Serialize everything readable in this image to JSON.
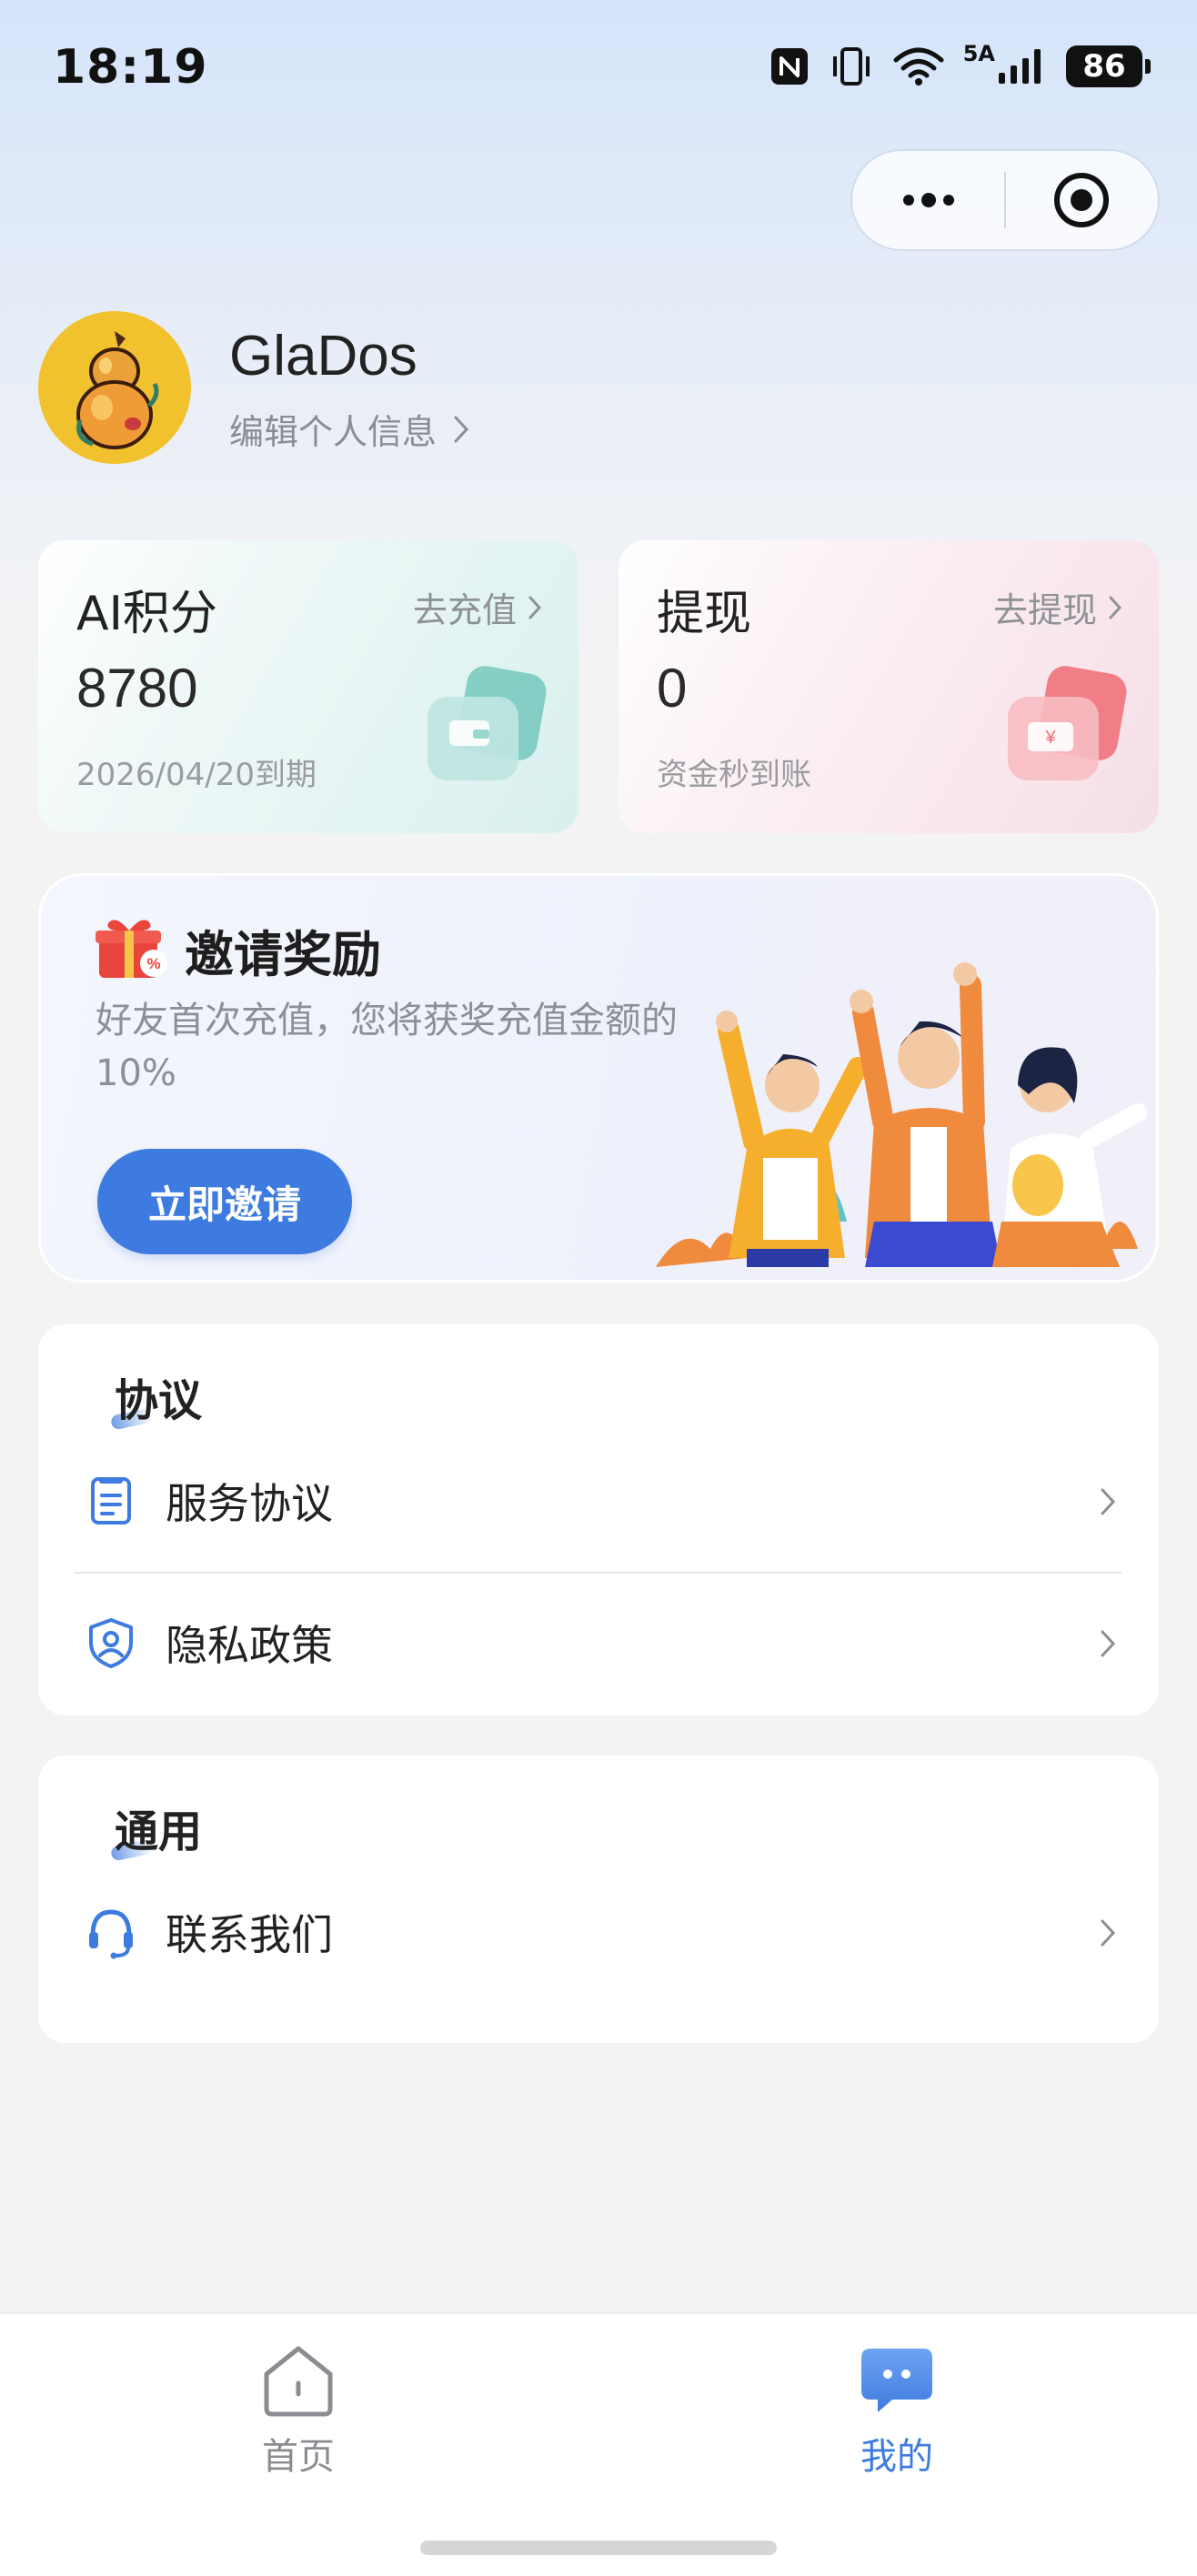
{
  "status_bar": {
    "time": "18:19",
    "network_label": "5A",
    "battery": "86",
    "icons": [
      "nfc-icon",
      "vibrate-icon",
      "wifi-icon",
      "signal-icon",
      "battery-icon"
    ]
  },
  "capsule": {
    "icons": [
      "more-dots-icon",
      "close-target-icon"
    ]
  },
  "profile": {
    "username": "GlaDos",
    "edit_label": "编辑个人信息"
  },
  "points_card": {
    "title": "AI积分",
    "link": "去充值",
    "value": "8780",
    "subtitle": "2026/04/20到期",
    "icon": "wallet-icon",
    "accent": "#7fcfc6"
  },
  "withdraw_card": {
    "title": "提现",
    "link": "去提现",
    "value": "0",
    "subtitle": "资金秒到账",
    "icon": "ticket-icon",
    "accent": "#f07a82"
  },
  "invite": {
    "title": "邀请奖励",
    "description": "好友首次充值，您将获奖充值金额的10%",
    "button": "立即邀请",
    "button_color": "#3e7be0"
  },
  "agreement_section": {
    "title": "协议",
    "items": [
      {
        "label": "服务协议",
        "icon": "document-icon"
      },
      {
        "label": "隐私政策",
        "icon": "shield-user-icon"
      }
    ]
  },
  "general_section": {
    "title": "通用",
    "items": [
      {
        "label": "联系我们",
        "icon": "headset-icon"
      }
    ]
  },
  "tabbar": {
    "tabs": [
      {
        "label": "首页",
        "icon": "home-icon",
        "active": false
      },
      {
        "label": "我的",
        "icon": "chat-bubble-icon",
        "active": true
      }
    ],
    "active_color": "#3e7be0",
    "inactive_color": "#8a8c91"
  }
}
